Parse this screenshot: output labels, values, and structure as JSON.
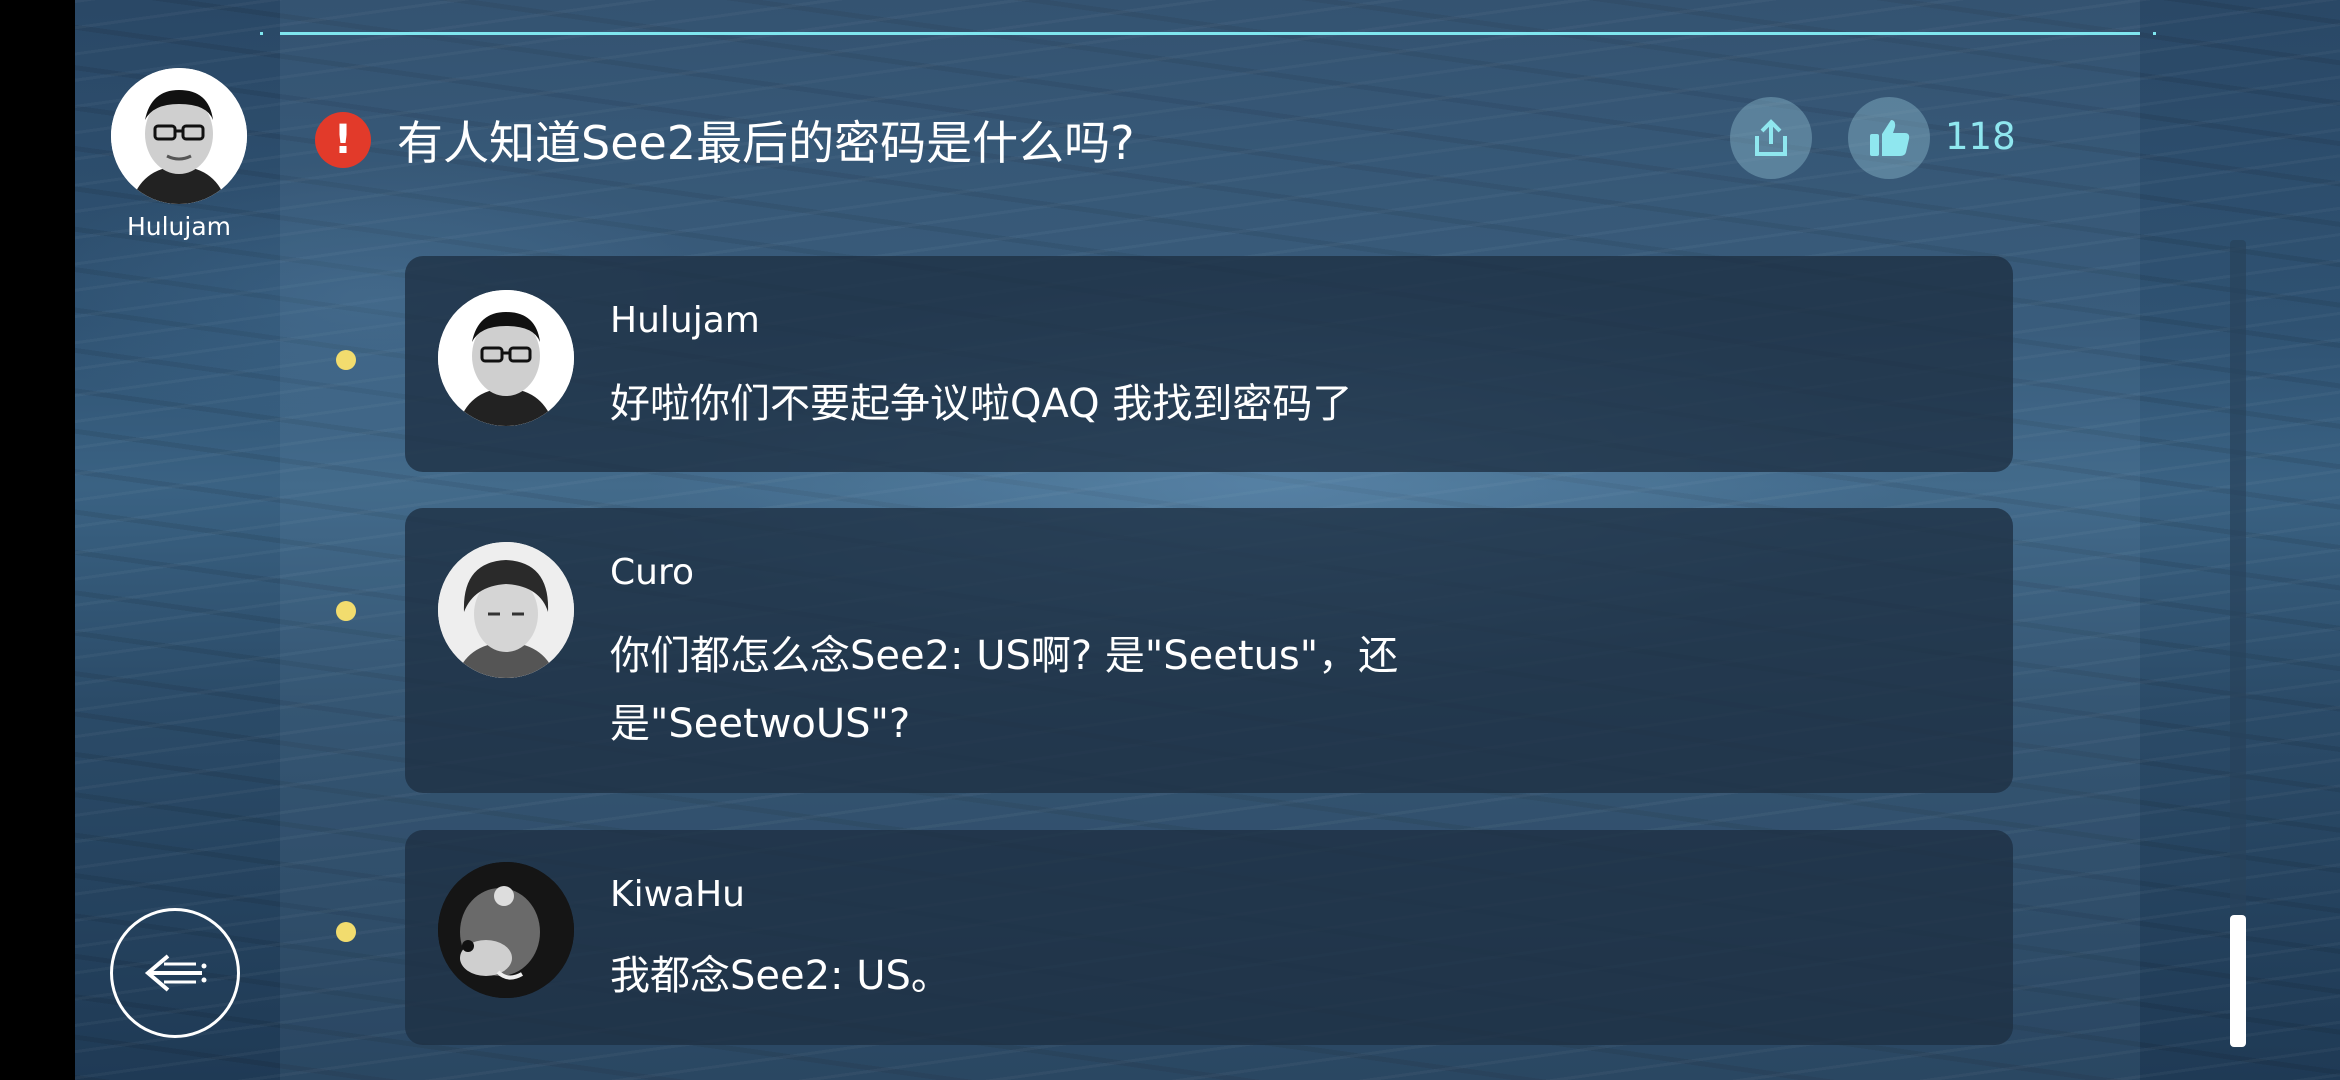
{
  "post": {
    "author": "Hulujam",
    "title": "有人知道See2最后的密码是什么吗?",
    "like_count": "118"
  },
  "icons": {
    "alert": "exclamation-icon",
    "share": "share-icon",
    "like": "thumbs-up-icon",
    "back": "back-arrow-icon"
  },
  "colors": {
    "accent": "#7fe6ef",
    "alert": "#e23a2a",
    "bullet": "#f2dc6e"
  },
  "comments": [
    {
      "name": "Hulujam",
      "text": "好啦你们不要起争议啦QAQ 我找到密码了"
    },
    {
      "name": "Curo",
      "text": "你们都怎么念See2: US啊? 是\"Seetus\"，还是\"SeetwoUS\"?"
    },
    {
      "name": "KiwaHu",
      "text": "我都念See2: US。"
    }
  ]
}
